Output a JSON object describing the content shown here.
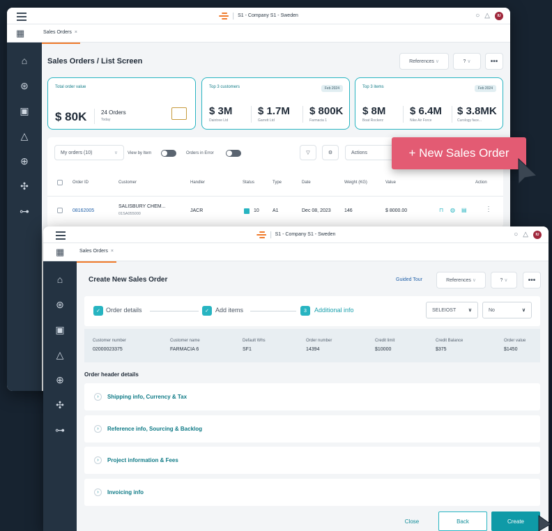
{
  "app": {
    "company": "S1 - Company S1 - Sweden",
    "avatar_initials": "IU",
    "tab_label": "Sales Orders",
    "tab_close": "×"
  },
  "list_screen": {
    "title": "Sales Orders / List Screen",
    "references_label": "References",
    "kpi": {
      "total": {
        "title": "Total order value",
        "value": "$ 80K",
        "orders": "24 Orders",
        "orders_sub": "Today"
      },
      "customers": {
        "title": "Top 3 customers",
        "badge": "Feb 2024",
        "items": [
          {
            "value": "$ 3M",
            "name": "Daintree Ltd"
          },
          {
            "value": "$ 1.7M",
            "name": "Garrett Ltd"
          },
          {
            "value": "$ 800K",
            "name": "Farmacia 1"
          }
        ]
      },
      "items": {
        "title": "Top 3 items",
        "badge": "Feb 2024",
        "items": [
          {
            "value": "$ 8M",
            "name": "Boat Rockerz"
          },
          {
            "value": "$ 6.4M",
            "name": "Nike Air Force"
          },
          {
            "value": "$ 3.8MK",
            "name": "Curology face..."
          }
        ]
      }
    },
    "filters": {
      "my_orders": "My orders (10)",
      "view_by_item": "View by Item",
      "orders_in_error": "Orders in Error",
      "actions": "Actions"
    },
    "columns": [
      "Order ID",
      "Customer",
      "Handler",
      "Status",
      "Type",
      "Date",
      "Weight (KG)",
      "Value",
      "Action"
    ],
    "row": {
      "order_id": "08162005",
      "customer": "SALISBURY CHEM...",
      "customer_code": "01SA055000",
      "handler": "JACR",
      "status": "10",
      "type": "A1",
      "date": "Dec 08, 2023",
      "weight": "146",
      "value": "$ 8000.00"
    }
  },
  "promo_button": "+ New Sales Order",
  "create_screen": {
    "title": "Create New Sales Order",
    "guided_tour": "Guided Tour",
    "references_label": "References",
    "steps": [
      {
        "num": "",
        "label": "Order details"
      },
      {
        "num": "",
        "label": "Add items"
      },
      {
        "num": "3",
        "label": "Additional info"
      }
    ],
    "select1": "SELEIOST",
    "select2": "No",
    "info": [
      {
        "label": "Customer number",
        "value": "02000023375"
      },
      {
        "label": "Customer name",
        "value": "FARMACIA 6"
      },
      {
        "label": "Default Whs",
        "value": "SF1"
      },
      {
        "label": "Order number",
        "value": "14394"
      },
      {
        "label": "Credit limit",
        "value": "$10000"
      },
      {
        "label": "Credit Balance",
        "value": "$375"
      },
      {
        "label": "Order value",
        "value": "$1450"
      }
    ],
    "section_title": "Order header details",
    "accordions": [
      "Shipping info, Currency & Tax",
      "Reference info, Sourcing & Backlog",
      "Project information & Fees",
      "Invoicing info"
    ],
    "footer": {
      "close": "Close",
      "back": "Back",
      "create": "Create"
    }
  },
  "colors": {
    "accent": "#27b4c1",
    "brand_orange": "#f07a2a",
    "promo": "#e35b73",
    "create": "#0f9aa7",
    "sidebar": "#243342"
  }
}
